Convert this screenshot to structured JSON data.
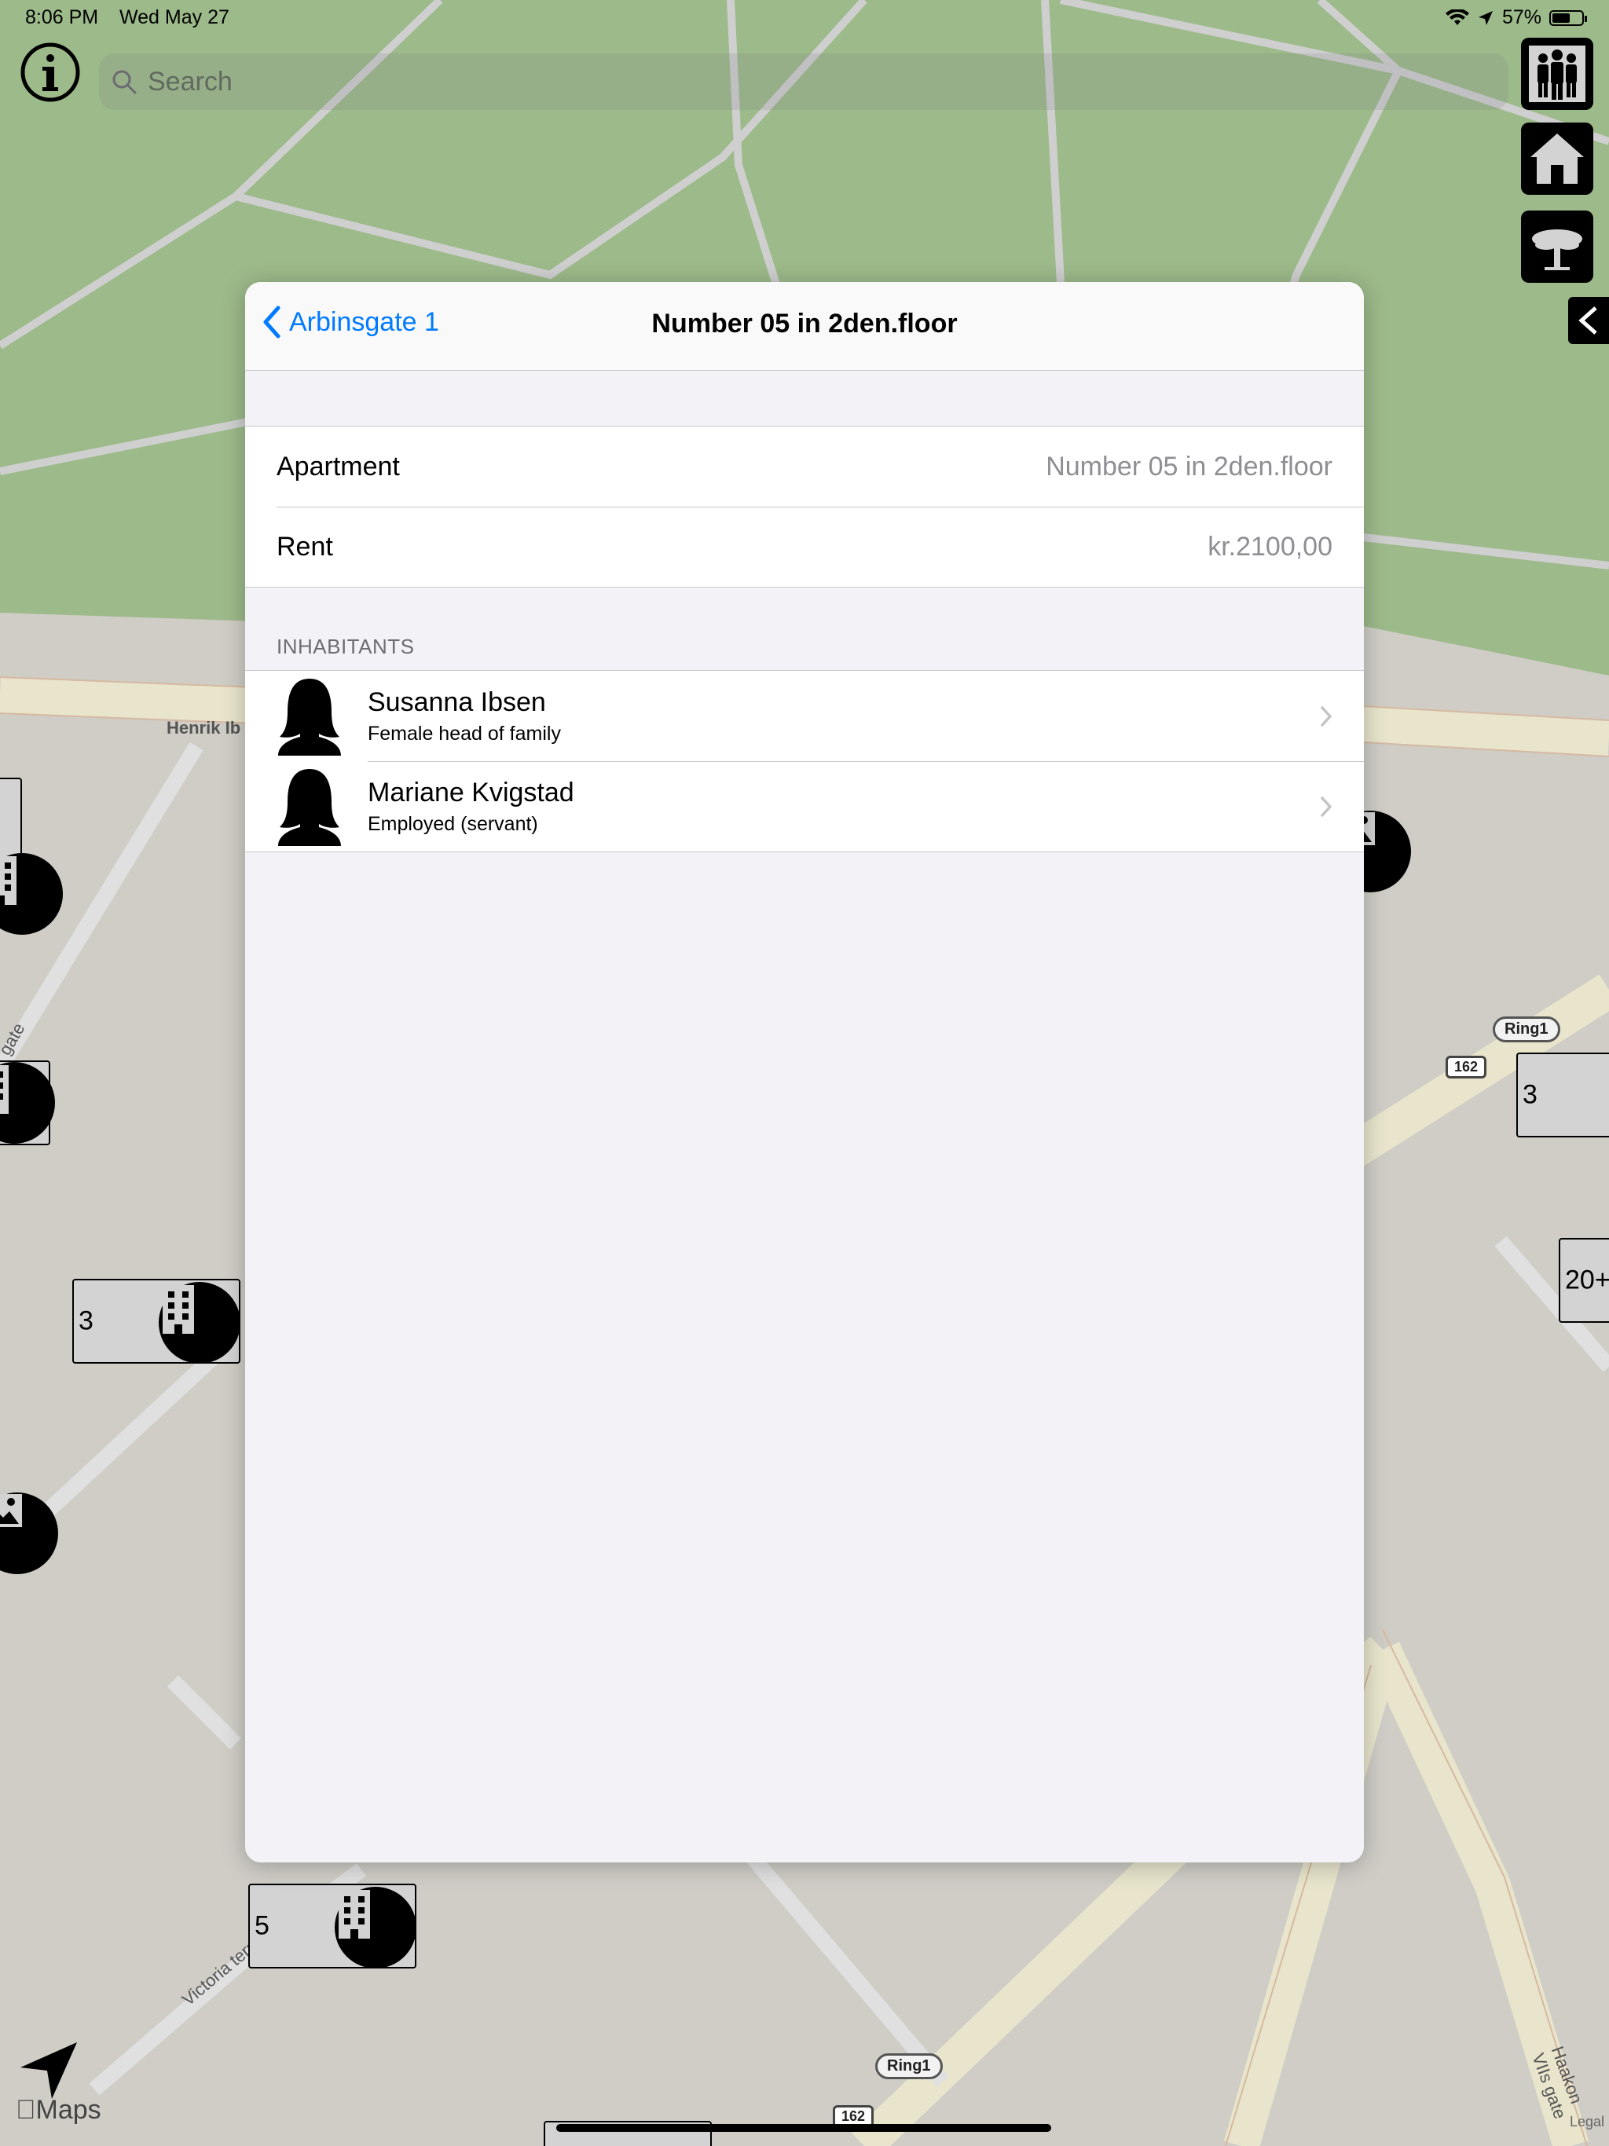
{
  "status_bar": {
    "time": "8:06 PM",
    "date": "Wed May 27",
    "battery": "57%"
  },
  "search": {
    "placeholder": "Search"
  },
  "map": {
    "road_label_1": "Henrik Ib",
    "road_label_2": "Victoria terr",
    "road_label_3": "Haakon VIIs gate",
    "road_label_4": "gate",
    "ring_shield": "Ring1",
    "route_number": "162",
    "clusters": [
      "3",
      "5",
      "3",
      "20+"
    ],
    "legal": "Legal",
    "brand": "Maps"
  },
  "sidebar_buttons": [
    "people-icon",
    "house-icon",
    "tree-icon"
  ],
  "modal": {
    "back_label": "Arbinsgate 1",
    "title": "Number 05 in 2den.floor",
    "details": [
      {
        "label": "Apartment",
        "value": "Number 05 in 2den.floor"
      },
      {
        "label": "Rent",
        "value": "kr.2100,00"
      }
    ],
    "inhabitants_header": "INHABITANTS",
    "inhabitants": [
      {
        "name": "Susanna Ibsen",
        "role": "Female head of family"
      },
      {
        "name": "Mariane Kvigstad",
        "role": "Employed (servant)"
      }
    ]
  }
}
